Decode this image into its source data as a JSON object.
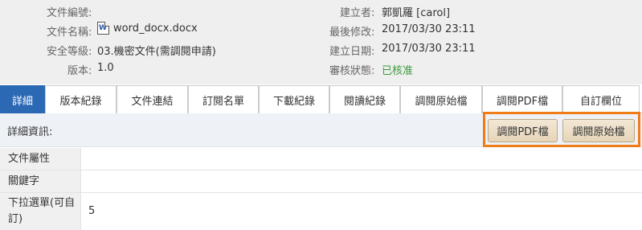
{
  "meta": {
    "file_no_label": "文件編號:",
    "file_no_value": "",
    "file_name_label": "文件名稱:",
    "file_name_value": "word_docx.docx",
    "security_label": "安全等級:",
    "security_value": "03.機密文件(需調閱申請)",
    "version_label": "版本:",
    "version_value": "1.0",
    "creator_label": "建立者:",
    "creator_value": "郭凱羅 [carol]",
    "modified_label": "最後修改:",
    "modified_value": "2017/03/30 23:11",
    "created_label": "建立日期:",
    "created_value": "2017/03/30 23:11",
    "review_label": "審核狀態:",
    "review_value": "已核准",
    "review_color": "#3a9a3a"
  },
  "tabs": [
    {
      "label": "詳細"
    },
    {
      "label": "版本紀錄"
    },
    {
      "label": "文件連結"
    },
    {
      "label": "訂閱名單"
    },
    {
      "label": "下載紀錄"
    },
    {
      "label": "閱讀紀錄"
    },
    {
      "label": "調閱原始檔"
    },
    {
      "label": "調閱PDF檔"
    },
    {
      "label": "自訂欄位"
    }
  ],
  "active_tab": "詳細",
  "accent_color": "#2c69b5",
  "details": {
    "title": "詳細資訊:",
    "btn_pdf": "調閱PDF檔",
    "btn_original": "調閱原始檔",
    "rows": [
      {
        "label": "文件屬性",
        "value": ""
      },
      {
        "label": "關鍵字",
        "value": ""
      },
      {
        "label": "下拉選單(可自訂)",
        "value": "5"
      }
    ]
  }
}
